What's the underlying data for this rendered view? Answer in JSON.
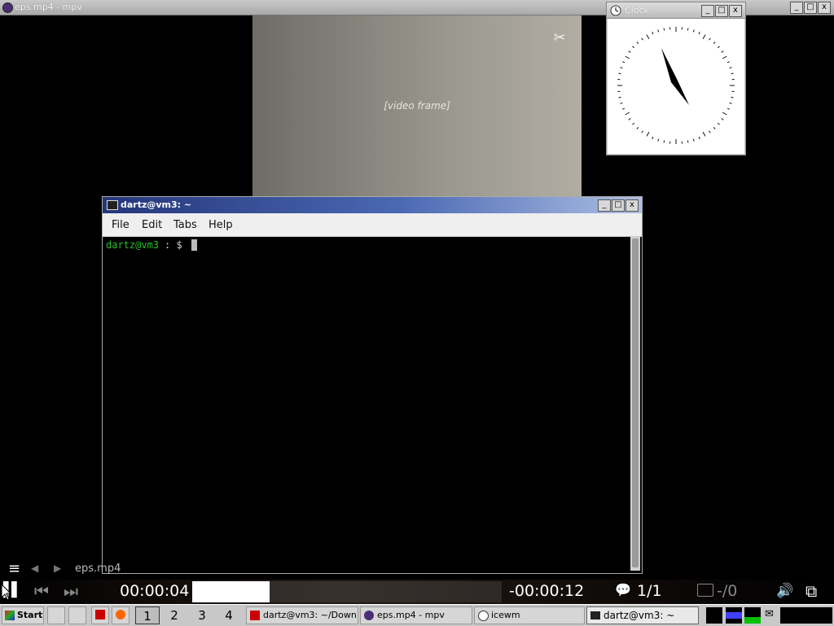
{
  "mpv_window": {
    "title": "eps.mp4 - mpv",
    "controls": [
      "_",
      "□",
      "x"
    ]
  },
  "video": {
    "placeholder": "[video frame]",
    "logo": "✂"
  },
  "clock_window": {
    "title": "Clock",
    "controls": [
      "_",
      "□",
      "x"
    ]
  },
  "terminal": {
    "title": "dartz@vm3: ~",
    "controls": [
      "_",
      "□",
      "x"
    ],
    "menu": [
      "File",
      "Edit",
      "Tabs",
      "Help"
    ],
    "prompt_user": "dartz@vm3",
    "prompt_path": ": $"
  },
  "osc": {
    "playlist_icon": "≡",
    "prev_icon": "◀",
    "next_icon": "▶",
    "filename": "eps.mp4",
    "play_pause_icon": "▌▌",
    "skip_back_icon": "⏮",
    "skip_fwd_icon": "⏭",
    "elapsed": "00:00:04",
    "remaining": "-00:00:12",
    "progress": 0.25,
    "subtitle_track": "1/1",
    "sub_icon": "💬",
    "audio_sub": "-/0",
    "volume_icon": "🔊",
    "fullscreen_icon": "⧉"
  },
  "taskbar": {
    "start_label": "Start",
    "workspaces": [
      "1",
      "2",
      "3",
      "4"
    ],
    "active_workspace": 0,
    "tasks": [
      {
        "label": "dartz@vm3: ~/Down...",
        "active": false
      },
      {
        "label": "eps.mp4 - mpv",
        "active": false
      },
      {
        "label": "icewm",
        "active": false
      },
      {
        "label": "dartz@vm3: ~",
        "active": true
      }
    ],
    "colors": {
      "cpu": "#00c000",
      "mem": "#4040ff"
    }
  }
}
